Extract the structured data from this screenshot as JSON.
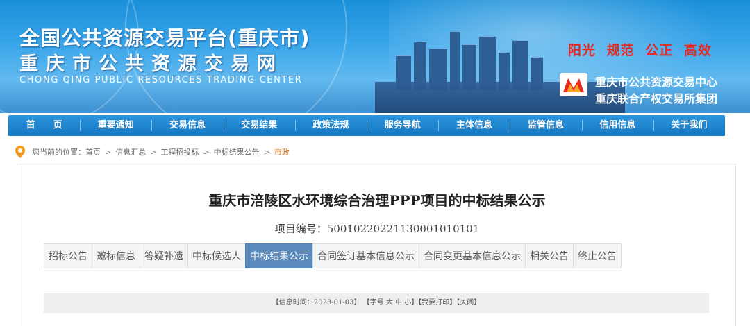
{
  "header": {
    "title_line1": "全国公共资源交易平台(重庆市)",
    "title_line2": "重庆市公共资源交易网",
    "title_en": "CHONG QING PUBLIC RESOURCES TRADING CENTER",
    "slogan": "阳光 规范 公正 高效",
    "org_line1": "重庆市公共资源交易中心",
    "org_line2": "重庆联合产权交易所集团"
  },
  "nav": {
    "items": [
      "首　　页",
      "重要通知",
      "交易信息",
      "交易结果",
      "政策法规",
      "服务导航",
      "主体信息",
      "监管信息",
      "信用信息",
      "关于我们"
    ]
  },
  "breadcrumb": {
    "prefix": "您当前的位置：",
    "items": [
      "首页",
      "信息汇总",
      "工程招投标",
      "中标结果公告"
    ],
    "current": "市政"
  },
  "document": {
    "title": "重庆市涪陵区水环境综合治理PPP项目的中标结果公示",
    "project_no_label": "项目编号：",
    "project_no": "500102202211300010101​01"
  },
  "tabs": {
    "items": [
      "招标公告",
      "邀标信息",
      "答疑补遗",
      "中标候选人",
      "中标结果公示",
      "合同签订基本信息公示",
      "合同变更基本信息公示",
      "相关公告",
      "终止公告"
    ],
    "active_index": 4
  },
  "infobar": {
    "time_label": "【信息时间：2023-01-03】",
    "font_label": "【字号",
    "font_large": "大",
    "font_medium": "中",
    "font_small": "小】",
    "print": "【我要打印】",
    "close": "【关闭】"
  },
  "colors": {
    "nav_bg": "#1a84cf",
    "active_tab": "#5b8bbd",
    "slogan": "#e8281e",
    "breadcrumb_current": "#d6731b"
  }
}
